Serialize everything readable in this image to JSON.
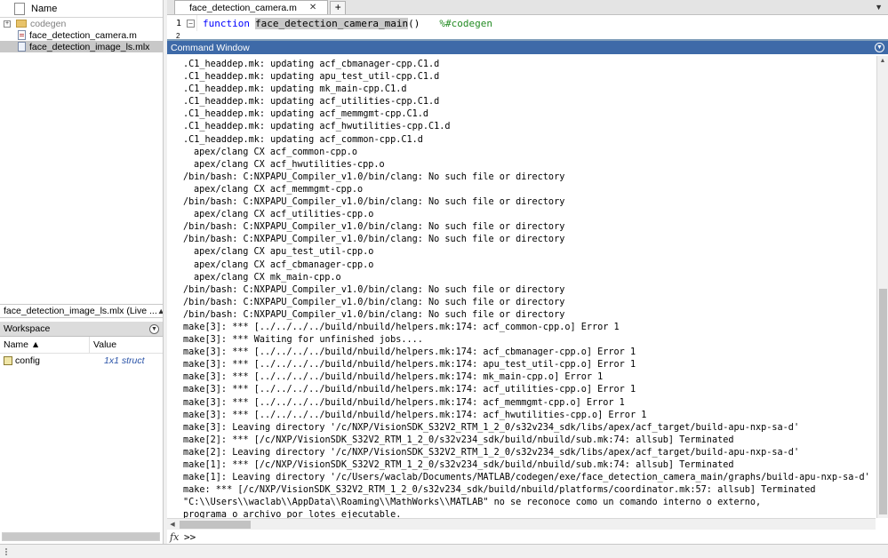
{
  "file_browser": {
    "header_label": "Name",
    "items": [
      {
        "label": "codegen",
        "type": "folder"
      },
      {
        "label": "face_detection_camera.m",
        "type": "m-file"
      },
      {
        "label": "face_detection_image_ls.mlx",
        "type": "live-script",
        "selected": true
      }
    ]
  },
  "details": {
    "label": "face_detection_image_ls.mlx (Live ..."
  },
  "workspace": {
    "title": "Workspace",
    "columns": {
      "name": "Name ▲",
      "value": "Value"
    },
    "rows": [
      {
        "name": "config",
        "value": "1x1 struct"
      }
    ]
  },
  "editor": {
    "tab_label": "face_detection_camera.m",
    "line_number": "1",
    "line_number_2": "2",
    "code": {
      "keyword": "function",
      "name": "face_detection_camera_main",
      "parens": "()",
      "comment": "%#codegen"
    }
  },
  "command_window": {
    "title": "Command Window",
    "prompt": ">>",
    "fx_label": "fx",
    "lines": [
      {
        "text": ".C1_headdep.mk: updating acf_cbmanager-cpp.C1.d"
      },
      {
        "text": ".C1_headdep.mk: updating apu_test_util-cpp.C1.d"
      },
      {
        "text": ".C1_headdep.mk: updating mk_main-cpp.C1.d"
      },
      {
        "text": ".C1_headdep.mk: updating acf_utilities-cpp.C1.d"
      },
      {
        "text": ".C1_headdep.mk: updating acf_memmgmt-cpp.C1.d"
      },
      {
        "text": ".C1_headdep.mk: updating acf_hwutilities-cpp.C1.d"
      },
      {
        "text": ".C1_headdep.mk: updating acf_common-cpp.C1.d"
      },
      {
        "text": "apex/clang CX acf_common-cpp.o",
        "indent": true
      },
      {
        "text": "apex/clang CX acf_hwutilities-cpp.o",
        "indent": true
      },
      {
        "text": "/bin/bash: C:NXPAPU_Compiler_v1.0/bin/clang: No such file or directory"
      },
      {
        "text": "apex/clang CX acf_memmgmt-cpp.o",
        "indent": true
      },
      {
        "text": "/bin/bash: C:NXPAPU_Compiler_v1.0/bin/clang: No such file or directory"
      },
      {
        "text": "apex/clang CX acf_utilities-cpp.o",
        "indent": true
      },
      {
        "text": "/bin/bash: C:NXPAPU_Compiler_v1.0/bin/clang: No such file or directory"
      },
      {
        "text": "/bin/bash: C:NXPAPU_Compiler_v1.0/bin/clang: No such file or directory"
      },
      {
        "text": "apex/clang CX apu_test_util-cpp.o",
        "indent": true
      },
      {
        "text": "apex/clang CX acf_cbmanager-cpp.o",
        "indent": true
      },
      {
        "text": "apex/clang CX mk_main-cpp.o",
        "indent": true
      },
      {
        "text": "/bin/bash: C:NXPAPU_Compiler_v1.0/bin/clang: No such file or directory"
      },
      {
        "text": "/bin/bash: C:NXPAPU_Compiler_v1.0/bin/clang: No such file or directory"
      },
      {
        "text": "/bin/bash: C:NXPAPU_Compiler_v1.0/bin/clang: No such file or directory"
      },
      {
        "text": "make[3]: *** [../../../../build/nbuild/helpers.mk:174: acf_common-cpp.o] Error 1"
      },
      {
        "text": "make[3]: *** Waiting for unfinished jobs...."
      },
      {
        "text": "make[3]: *** [../../../../build/nbuild/helpers.mk:174: acf_cbmanager-cpp.o] Error 1"
      },
      {
        "text": "make[3]: *** [../../../../build/nbuild/helpers.mk:174: apu_test_util-cpp.o] Error 1"
      },
      {
        "text": "make[3]: *** [../../../../build/nbuild/helpers.mk:174: mk_main-cpp.o] Error 1"
      },
      {
        "text": "make[3]: *** [../../../../build/nbuild/helpers.mk:174: acf_utilities-cpp.o] Error 1"
      },
      {
        "text": "make[3]: *** [../../../../build/nbuild/helpers.mk:174: acf_memmgmt-cpp.o] Error 1"
      },
      {
        "text": "make[3]: *** [../../../../build/nbuild/helpers.mk:174: acf_hwutilities-cpp.o] Error 1"
      },
      {
        "text": "make[3]: Leaving directory '/c/NXP/VisionSDK_S32V2_RTM_1_2_0/s32v234_sdk/libs/apex/acf_target/build-apu-nxp-sa-d'"
      },
      {
        "text": "make[2]: *** [/c/NXP/VisionSDK_S32V2_RTM_1_2_0/s32v234_sdk/build/nbuild/sub.mk:74: allsub] Terminated"
      },
      {
        "text": "make[2]: Leaving directory '/c/NXP/VisionSDK_S32V2_RTM_1_2_0/s32v234_sdk/libs/apex/acf_target/build-apu-nxp-sa-d'"
      },
      {
        "text": "make[1]: *** [/c/NXP/VisionSDK_S32V2_RTM_1_2_0/s32v234_sdk/build/nbuild/sub.mk:74: allsub] Terminated"
      },
      {
        "text": "make[1]: Leaving directory '/c/Users/waclab/Documents/MATLAB/codegen/exe/face_detection_camera_main/graphs/build-apu-nxp-sa-d'"
      },
      {
        "text": "make: *** [/c/NXP/VisionSDK_S32V2_RTM_1_2_0/s32v234_sdk/build/nbuild/platforms/coordinator.mk:57: allsub] Terminated"
      },
      {
        "text": "\"C:\\\\Users\\\\waclab\\\\AppData\\\\Roaming\\\\MathWorks\\\\MATLAB\" no se reconoce como un comando interno o externo,"
      },
      {
        "text": "programa o archivo por lotes ejecutable."
      }
    ]
  },
  "colors": {
    "command_title_bg": "#3e6aa8",
    "keyword": "#0000ff",
    "comment": "#228b22",
    "workspace_value": "#2b54a8",
    "selection": "#c8c8c8"
  }
}
